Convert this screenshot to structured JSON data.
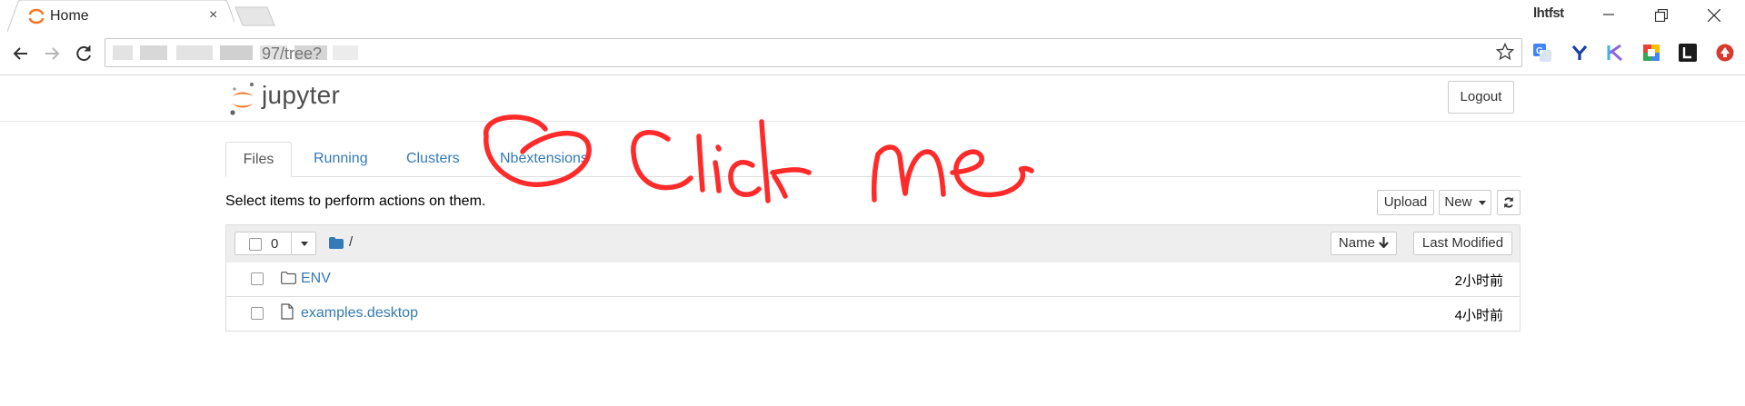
{
  "browser": {
    "tab_title": "Home",
    "tab_close": "×",
    "profile_name": "lhtfst",
    "url_visible": "97/tree?",
    "extensions": [
      "translate-extension-icon",
      "y-extension-icon",
      "k-extension-icon",
      "cube-extension-icon",
      "l-extension-icon",
      "red-circle-extension-icon"
    ]
  },
  "header": {
    "logo_text": "jupyter",
    "logout_label": "Logout"
  },
  "tabs": [
    {
      "label": "Files",
      "active": true
    },
    {
      "label": "Running",
      "active": false
    },
    {
      "label": "Clusters",
      "active": false
    },
    {
      "label": "Nbextensions",
      "active": false
    }
  ],
  "toolbar": {
    "hint": "Select items to perform actions on them.",
    "upload_label": "Upload",
    "new_label": "New",
    "refresh_icon": "refresh-icon"
  },
  "list": {
    "selected_count": "0",
    "path": "/",
    "sort_name_label": "Name",
    "sort_modified_label": "Last Modified",
    "items": [
      {
        "type": "folder",
        "name": "ENV",
        "modified": "2小时前"
      },
      {
        "type": "file",
        "name": "examples.desktop",
        "modified": "4小时前"
      }
    ]
  },
  "annotation": {
    "text": "Click me",
    "color": "#ff2a2a"
  },
  "colors": {
    "link": "#337ab7",
    "jupyter_orange": "#f37726"
  }
}
